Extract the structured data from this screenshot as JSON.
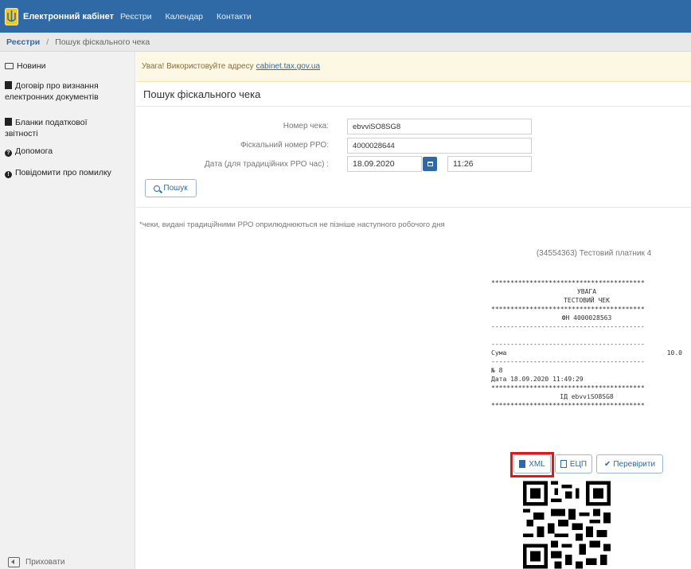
{
  "navbar": {
    "brand": "Електронний кабінет",
    "links": [
      "Реєстри",
      "Календар",
      "Контакти"
    ]
  },
  "breadcrumb": {
    "root": "Реєстри",
    "separator": "/",
    "current": "Пошук фіскального чека"
  },
  "sidebar": {
    "items": [
      {
        "label": "Новини",
        "icon": "news-icon"
      },
      {
        "label": "Договір про визнання електронних документів",
        "icon": "document-icon"
      },
      {
        "label": "Бланки податкової звітності",
        "icon": "document-icon"
      },
      {
        "label": "Допомога",
        "icon": "question-icon"
      },
      {
        "label": "Повідомити про помилку",
        "icon": "exclamation-icon"
      }
    ],
    "hide_label": "Приховати"
  },
  "alert": {
    "text": "Увага! Використовуйте адресу",
    "link": "cabinet.tax.gov.ua"
  },
  "page_title": "Пошук фіскального чека",
  "form": {
    "receipt_number_label": "Номер чека:",
    "receipt_number_value": "ebvviSO8SG8",
    "fiscal_number_label": "Фіскальний номер РРО:",
    "fiscal_number_value": "4000028644",
    "date_label": "Дата (для традиційних РРО час) :",
    "date_value": "18.09.2020",
    "time_value": "11:26",
    "search_button": "Пошук"
  },
  "note": "*чеки, видані традиційними РРО оприлюднюються не пізніше наступного робочого дня",
  "receipt": {
    "header": "(34554363) Тестовий платник 4",
    "stars": "****************************************",
    "dashes": "----------------------------------------",
    "warning": "УВАГА",
    "test_receipt": "ТЕСТОВИЙ ЧЕК",
    "fn": "ФН 4000028563",
    "sum_label": "Сума",
    "sum_value": "10.0",
    "number": "№ 8",
    "date": "Дата 18.09.2020 11:49:29",
    "id": "ІД ebvviSO8SG8"
  },
  "receipt_buttons": {
    "xml": "XML",
    "ecp": "ЕЦП",
    "verify": "Перевірити"
  },
  "colors": {
    "navbar": "#2f6aa6",
    "alert_bg": "#fcf8e3",
    "highlight": "#e0161b"
  }
}
